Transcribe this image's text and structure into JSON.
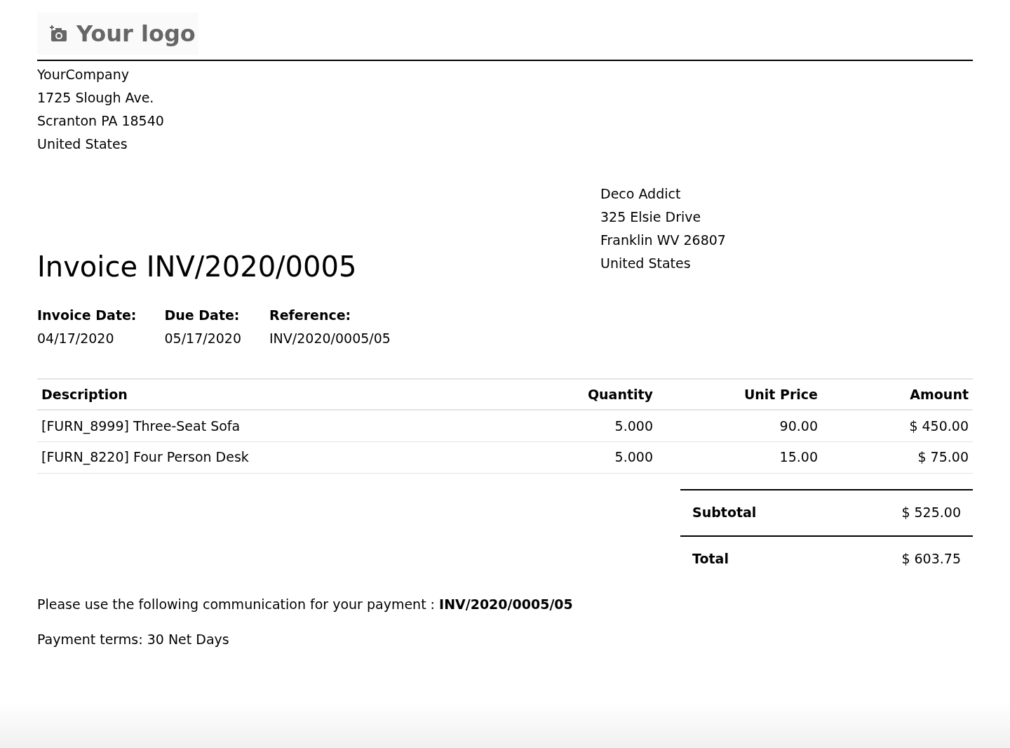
{
  "logo": {
    "text": "Your logo"
  },
  "company": {
    "lines": [
      "YourCompany",
      "1725 Slough Ave.",
      "Scranton PA 18540",
      "United States"
    ]
  },
  "customer": {
    "lines": [
      "Deco Addict",
      "325 Elsie Drive",
      "Franklin WV 26807",
      "United States"
    ]
  },
  "title": "Invoice INV/2020/0005",
  "info": [
    {
      "label": "Invoice Date:",
      "value": "04/17/2020"
    },
    {
      "label": "Due Date:",
      "value": "05/17/2020"
    },
    {
      "label": "Reference:",
      "value": "INV/2020/0005/05"
    }
  ],
  "table": {
    "columns": [
      "Description",
      "Quantity",
      "Unit Price",
      "Amount"
    ],
    "rows": [
      [
        "[FURN_8999] Three-Seat Sofa",
        "5.000",
        "90.00",
        "$ 450.00"
      ],
      [
        "[FURN_8220] Four Person Desk",
        "5.000",
        "15.00",
        "$ 75.00"
      ]
    ]
  },
  "totals": [
    {
      "label": "Subtotal",
      "value": "$ 525.00"
    },
    {
      "label": "Total",
      "value": "$ 603.75"
    }
  ],
  "communication": "Please use the following communication for your payment : **INV/2020/0005/05**",
  "payment_terms": "Payment terms: 30 Net Days"
}
